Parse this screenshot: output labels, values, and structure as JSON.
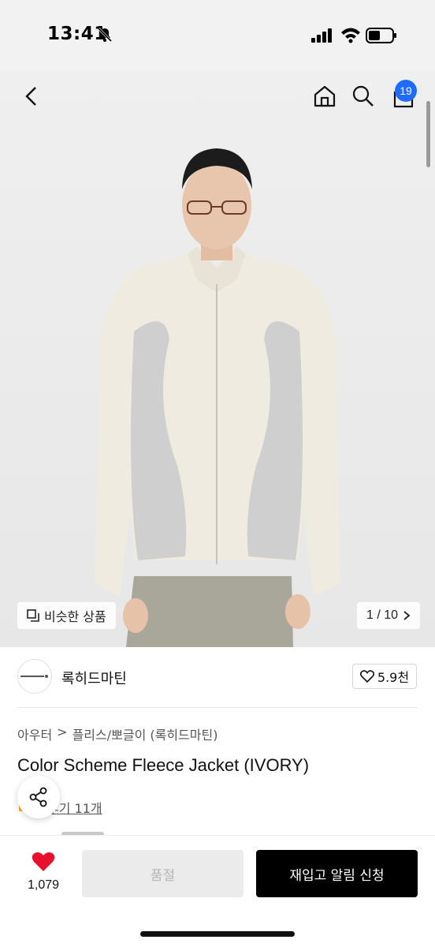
{
  "status_bar": {
    "time": "13:41"
  },
  "nav": {
    "cart_count": "19"
  },
  "gallery": {
    "similar_label": "비슷한 상품",
    "page_counter": "1 / 10"
  },
  "brand": {
    "name": "록히드마틴",
    "likes": "5.9천"
  },
  "breadcrumb": {
    "category": "아우터",
    "subcategory": "플리스/뽀글이 (록히드마틴)"
  },
  "product": {
    "title": "Color Scheme Fleece Jacket (IVORY)",
    "reviews": "후기 11개"
  },
  "bottom_bar": {
    "wish_count": "1,079",
    "soldout_label": "품절",
    "restock_label": "재입고 알림 신청"
  },
  "colors": {
    "accent": "#1f6bff",
    "heart": "#e8112d"
  }
}
